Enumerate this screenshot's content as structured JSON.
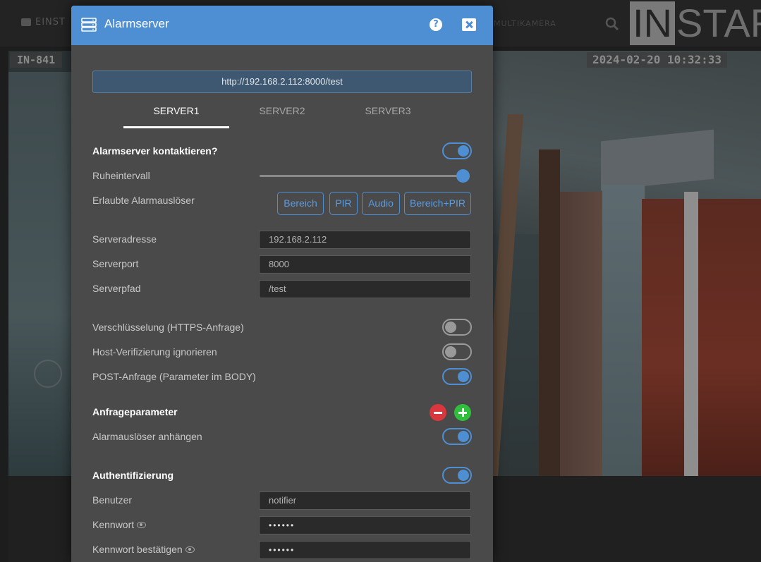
{
  "background": {
    "nav_left": "EINST",
    "nav_right": "MULTIKAMERA",
    "logo_box": "IN",
    "logo_rest": "STAR",
    "osd_left": "IN-841",
    "osd_datetime": "2024-02-20 10:32:33"
  },
  "modal": {
    "title": "Alarmserver",
    "icon": "server-stack-icon",
    "help_icon": "question-circle-icon",
    "help_glyph": "?",
    "close_icon": "close-icon",
    "url_preview": "http://192.168.2.112:8000/test",
    "tabs": [
      {
        "label": "SERVER1",
        "active": true
      },
      {
        "label": "SERVER2",
        "active": false
      },
      {
        "label": "SERVER3",
        "active": false
      }
    ],
    "contact": {
      "label": "Alarmserver kontaktieren?",
      "on": true
    },
    "rest_interval": {
      "label": "Ruheintervall",
      "value_fraction": 1.0
    },
    "triggers": {
      "label": "Erlaubte Alarmauslöser",
      "options": [
        "Bereich",
        "PIR",
        "Audio",
        "Bereich+PIR"
      ]
    },
    "server_address": {
      "label": "Serveradresse",
      "value": "192.168.2.112"
    },
    "server_port": {
      "label": "Serverport",
      "value": "8000"
    },
    "server_path": {
      "label": "Serverpfad",
      "value": "/test"
    },
    "https": {
      "label": "Verschlüsselung (HTTPS-Anfrage)",
      "on": false
    },
    "ignore_host": {
      "label": "Host-Verifizierung ignorieren",
      "on": false
    },
    "post": {
      "label": "POST-Anfrage (Parameter im BODY)",
      "on": true
    },
    "query_params": {
      "label": "Anfrageparameter"
    },
    "append_trigger": {
      "label": "Alarmauslöser anhängen",
      "on": true
    },
    "auth": {
      "label": "Authentifizierung",
      "on": true
    },
    "user": {
      "label": "Benutzer",
      "value": "notifier"
    },
    "password": {
      "label": "Kennwort",
      "value": "••••••"
    },
    "password_confirm": {
      "label": "Kennwort bestätigen",
      "value": "••••••"
    }
  },
  "colors": {
    "accent": "#4e8fd4",
    "modal_bg": "#4a4a4a",
    "remove": "#d9363e",
    "add": "#2fbf3c"
  }
}
